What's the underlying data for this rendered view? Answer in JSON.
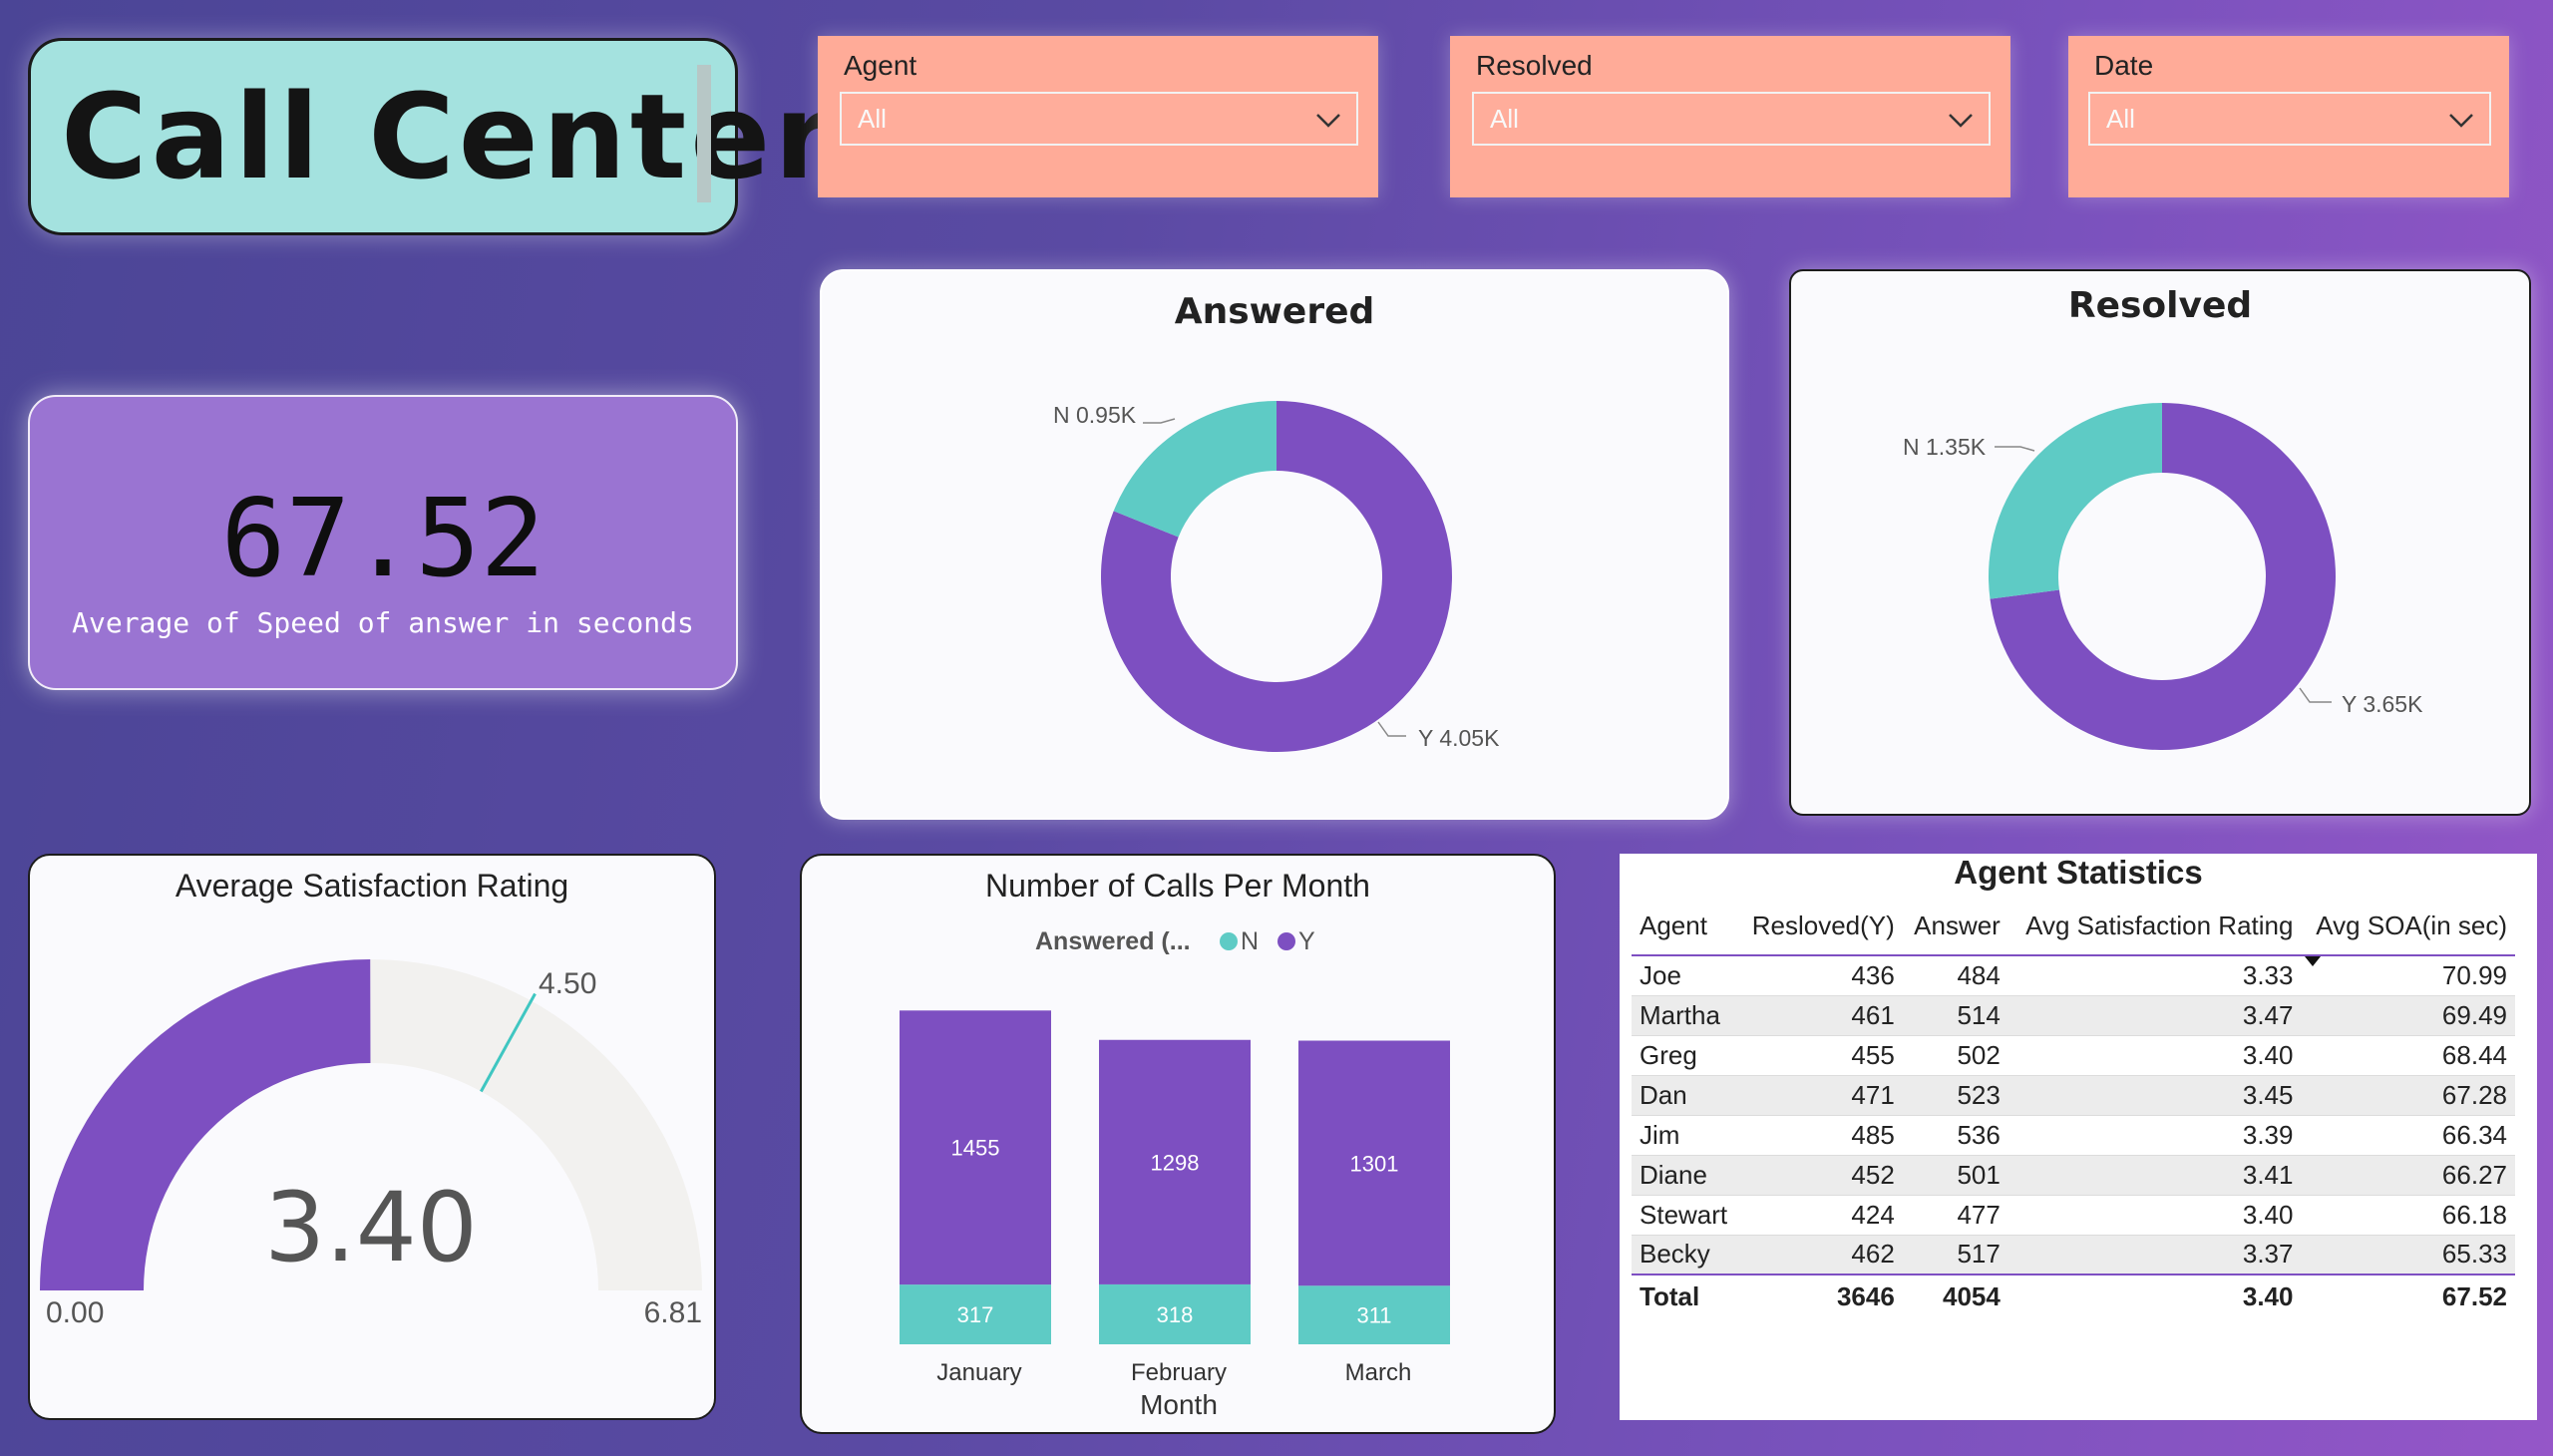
{
  "title": "Call Center",
  "slicers": [
    {
      "label": "Agent",
      "value": "All"
    },
    {
      "label": "Resolved",
      "value": "All"
    },
    {
      "label": "Date",
      "value": "All"
    }
  ],
  "kpi": {
    "value": "67.52",
    "label": "Average of Speed of answer in seconds"
  },
  "colors": {
    "purple": "#7d4fc1",
    "teal": "#5ecbc5",
    "gauge_track": "#f2f1ef",
    "gauge_target": "#3fc6c1",
    "slicer": "#ffab98"
  },
  "answered": {
    "title": "Answered",
    "n_label": "N 0.95K",
    "y_label": "Y 4.05K",
    "n_value": 946,
    "y_value": 4054
  },
  "resolved": {
    "title": "Resolved",
    "n_label": "N 1.35K",
    "y_label": "Y 3.65K",
    "n_value": 1354,
    "y_value": 3646
  },
  "gauge": {
    "title": "Average Satisfaction Rating",
    "value_label": "3.40",
    "min_label": "0.00",
    "max_label": "6.81",
    "target_label": "4.50",
    "value": 3.4,
    "min": 0,
    "max": 6.81,
    "target": 4.5
  },
  "calls_chart": {
    "title": "Number of Calls Per Month",
    "legend_title": "Answered (...",
    "legend_n": "N",
    "legend_y": "Y",
    "xlabel": "Month"
  },
  "chart_data": {
    "type": "bar",
    "stacked": true,
    "categories": [
      "January",
      "February",
      "March"
    ],
    "series": [
      {
        "name": "N",
        "values": [
          317,
          318,
          311
        ]
      },
      {
        "name": "Y",
        "values": [
          1455,
          1298,
          1301
        ]
      }
    ],
    "xlabel": "Month",
    "legend": "top"
  },
  "agent_stats": {
    "title": "Agent Statistics",
    "columns": [
      "Agent",
      "Resloved(Y)",
      "Answer",
      "Avg Satisfaction Rating",
      "Avg SOA(in sec)"
    ],
    "rows": [
      [
        "Joe",
        "436",
        "484",
        "3.33",
        "70.99"
      ],
      [
        "Martha",
        "461",
        "514",
        "3.47",
        "69.49"
      ],
      [
        "Greg",
        "455",
        "502",
        "3.40",
        "68.44"
      ],
      [
        "Dan",
        "471",
        "523",
        "3.45",
        "67.28"
      ],
      [
        "Jim",
        "485",
        "536",
        "3.39",
        "66.34"
      ],
      [
        "Diane",
        "452",
        "501",
        "3.41",
        "66.27"
      ],
      [
        "Stewart",
        "424",
        "477",
        "3.40",
        "66.18"
      ],
      [
        "Becky",
        "462",
        "517",
        "3.37",
        "65.33"
      ]
    ],
    "total": [
      "Total",
      "3646",
      "4054",
      "3.40",
      "67.52"
    ]
  }
}
